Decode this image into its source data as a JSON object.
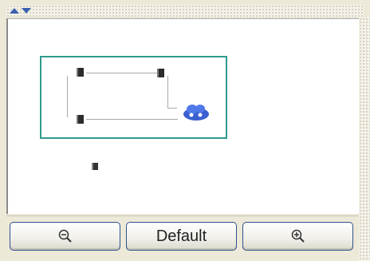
{
  "header": {
    "collapse_icon": "triangle-up-icon",
    "expand_icon": "triangle-down-icon"
  },
  "toolbar": {
    "zoom_out_icon": "magnifier-minus-icon",
    "default_label": "Default",
    "zoom_in_icon": "magnifier-plus-icon"
  },
  "colors": {
    "overview_border": "#2f9a8f",
    "button_border": "#2f4f8f",
    "router_icon": "#3a5fd0"
  }
}
